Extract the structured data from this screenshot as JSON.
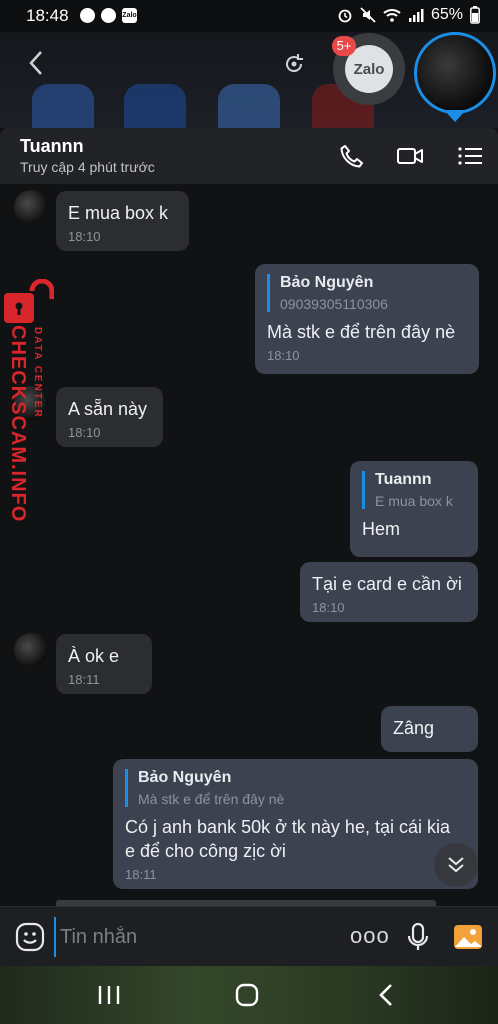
{
  "status_bar": {
    "time": "18:48",
    "battery": "65%",
    "zalo_mini": "Zalo"
  },
  "overlay": {
    "zalo_label": "Zalo",
    "badge": "5+"
  },
  "header": {
    "name": "Tuannn",
    "status": "Truy cập 4 phút trước"
  },
  "messages": [
    {
      "text": "E mua box k",
      "time": "18:10"
    },
    {
      "quote_name": "Bảo Nguyên",
      "quote_text": "09039305110306",
      "text": "Mà stk e để trên đây nè",
      "time": "18:10"
    },
    {
      "text": "A sẵn này",
      "time": "18:10"
    },
    {
      "quote_name": "Tuannn",
      "quote_text": "E mua box k",
      "text": "Hem"
    },
    {
      "text": "Tại e card e cần ời",
      "time": "18:10"
    },
    {
      "text": "À ok e",
      "time": "18:11"
    },
    {
      "text": "Zâng"
    },
    {
      "quote_name": "Bảo Nguyên",
      "quote_text": "Mà stk e để trên đây nè",
      "text_line1": "Có j anh bank 50k ở tk này he, tại cái kia",
      "text_line2": "e để cho công zịc ời",
      "time": "18:11"
    }
  ],
  "watermark": {
    "brand": "CHECKSCAM.INFO",
    "tag": "DATA CENTER"
  },
  "composer": {
    "placeholder": "Tin nhắn",
    "more": "ooo"
  },
  "colors": {
    "accent": "#1b8fe7",
    "incoming_bubble": "#2c2d31",
    "outgoing_bubble": "#3c4250",
    "watermark_red": "#d8262b"
  }
}
